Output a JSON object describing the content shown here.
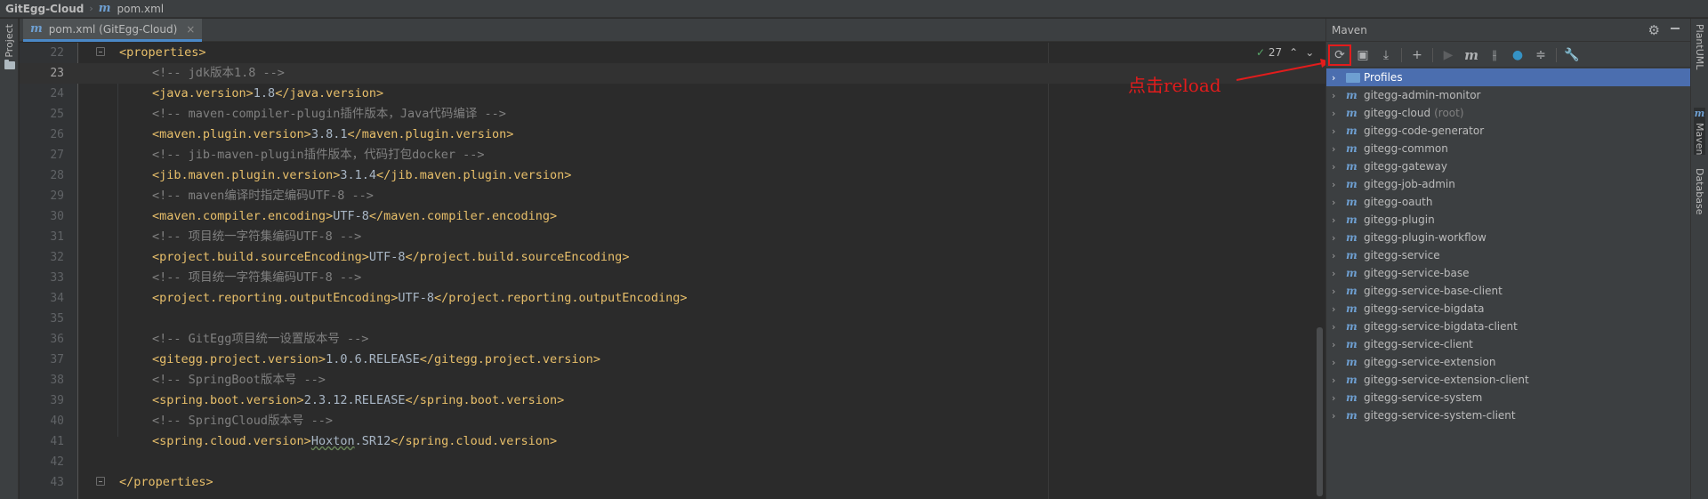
{
  "breadcrumb": {
    "project": "GitEgg-Cloud",
    "file": "pom.xml"
  },
  "left_stripe": {
    "project_tab": "Project"
  },
  "editor_tab": {
    "label": "pom.xml (GitEgg-Cloud)",
    "close": "×"
  },
  "inspection": {
    "count": "27"
  },
  "code_lines": [
    {
      "n": "22",
      "tag": "<properties>"
    },
    {
      "n": "23",
      "comment": "<!-- jdk版本1.8 -->"
    },
    {
      "n": "24",
      "open": "<java.version>",
      "value": "1.8",
      "close": "</java.version>"
    },
    {
      "n": "25",
      "comment": "<!-- maven-compiler-plugin插件版本，Java代码编译 -->"
    },
    {
      "n": "26",
      "open": "<maven.plugin.version>",
      "value": "3.8.1",
      "close": "</maven.plugin.version>"
    },
    {
      "n": "27",
      "comment": "<!-- jib-maven-plugin插件版本，代码打包docker -->"
    },
    {
      "n": "28",
      "open": "<jib.maven.plugin.version>",
      "value": "3.1.4",
      "close": "</jib.maven.plugin.version>"
    },
    {
      "n": "29",
      "comment": "<!-- maven编译时指定编码UTF-8 -->"
    },
    {
      "n": "30",
      "open": "<maven.compiler.encoding>",
      "value": "UTF-8",
      "close": "</maven.compiler.encoding>"
    },
    {
      "n": "31",
      "comment": "<!-- 项目统一字符集编码UTF-8 -->"
    },
    {
      "n": "32",
      "open": "<project.build.sourceEncoding>",
      "value": "UTF-8",
      "close": "</project.build.sourceEncoding>"
    },
    {
      "n": "33",
      "comment": "<!-- 项目统一字符集编码UTF-8 -->"
    },
    {
      "n": "34",
      "open": "<project.reporting.outputEncoding>",
      "value": "UTF-8",
      "close": "</project.reporting.outputEncoding>"
    },
    {
      "n": "35"
    },
    {
      "n": "36",
      "comment": "<!-- GitEgg项目统一设置版本号 -->"
    },
    {
      "n": "37",
      "open": "<gitegg.project.version>",
      "value": "1.0.6.RELEASE",
      "close": "</gitegg.project.version>"
    },
    {
      "n": "38",
      "comment": "<!-- SpringBoot版本号 -->"
    },
    {
      "n": "39",
      "open": "<spring.boot.version>",
      "value": "2.3.12.RELEASE",
      "close": "</spring.boot.version>"
    },
    {
      "n": "40",
      "comment": "<!-- SpringCloud版本号 -->"
    },
    {
      "n": "41",
      "open": "<spring.cloud.version>",
      "value_squiggle": "Hoxton",
      "value": ".SR12",
      "close": "</spring.cloud.version>"
    },
    {
      "n": "42"
    },
    {
      "n": "43",
      "tag": "</properties>"
    }
  ],
  "annotation": "点击reload",
  "maven": {
    "title": "Maven",
    "profiles": "Profiles",
    "modules": [
      "gitegg-admin-monitor",
      "gitegg-cloud",
      "gitegg-code-generator",
      "gitegg-common",
      "gitegg-gateway",
      "gitegg-job-admin",
      "gitegg-oauth",
      "gitegg-plugin",
      "gitegg-plugin-workflow",
      "gitegg-service",
      "gitegg-service-base",
      "gitegg-service-base-client",
      "gitegg-service-bigdata",
      "gitegg-service-bigdata-client",
      "gitegg-service-client",
      "gitegg-service-extension",
      "gitegg-service-extension-client",
      "gitegg-service-system",
      "gitegg-service-system-client"
    ],
    "root_label": "(root)"
  },
  "right_stripe": {
    "tabs": [
      "PlantUML",
      "Maven",
      "Database"
    ]
  },
  "colors": {
    "accent": "#4b6eaf",
    "annotation": "#e21c1c",
    "tag": "#e8bf6a",
    "comment": "#808080"
  }
}
